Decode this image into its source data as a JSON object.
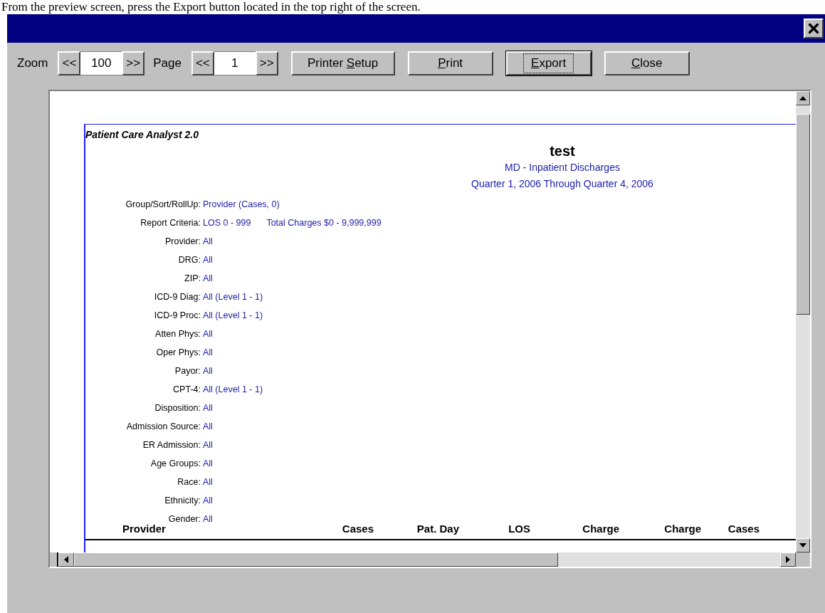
{
  "caption": "From the preview screen, press the Export button located in the top right of the screen.",
  "toolbar": {
    "zoom": {
      "label": "Zoom",
      "prev": "<<",
      "value": "100",
      "next": ">>"
    },
    "page": {
      "label": "Page",
      "prev": "<<",
      "value": "1",
      "next": ">>"
    },
    "buttons": [
      {
        "label_before": "Printer ",
        "mnemonic": "S",
        "label_after": "etup",
        "focused": false
      },
      {
        "mnemonic": "P",
        "label_after": "rint",
        "focused": false
      },
      {
        "mnemonic": "E",
        "label_after": "xport",
        "focused": true
      },
      {
        "mnemonic": "C",
        "label_after": "lose",
        "focused": false
      }
    ]
  },
  "report": {
    "app_title": "Patient Care Analyst 2.0",
    "title": "test",
    "subtitles": [
      "MD - Inpatient Discharges",
      "Quarter 1, 2006 Through Quarter 4, 2006"
    ],
    "criteria": [
      {
        "label": "Group/Sort/RollUp:",
        "values": [
          "Provider (Cases, 0)"
        ]
      },
      {
        "label": "Report Criteria:",
        "values": [
          "LOS 0 - 999",
          "Total Charges $0 - 9,999,999"
        ]
      },
      {
        "label": "Provider:",
        "values": [
          "All"
        ]
      },
      {
        "label": "DRG:",
        "values": [
          "All"
        ]
      },
      {
        "label": "ZIP:",
        "values": [
          "All"
        ]
      },
      {
        "label": "ICD-9 Diag:",
        "values": [
          "All (Level 1 - 1)"
        ]
      },
      {
        "label": "ICD-9 Proc:",
        "values": [
          "All (Level 1 - 1)"
        ]
      },
      {
        "label": "Atten Phys:",
        "values": [
          "All"
        ]
      },
      {
        "label": "Oper Phys:",
        "values": [
          "All"
        ]
      },
      {
        "label": "Payor:",
        "values": [
          "All"
        ]
      },
      {
        "label": "CPT-4:",
        "values": [
          "All (Level 1 - 1)"
        ]
      },
      {
        "label": "Disposition:",
        "values": [
          "All"
        ]
      },
      {
        "label": "Admission Source:",
        "values": [
          "All"
        ]
      },
      {
        "label": "ER Admission:",
        "values": [
          "All"
        ]
      },
      {
        "label": "Age Groups:",
        "values": [
          "All"
        ]
      },
      {
        "label": "Race:",
        "values": [
          "All"
        ]
      },
      {
        "label": "Ethnicity:",
        "values": [
          "All"
        ]
      },
      {
        "label": "Gender:",
        "values": [
          "All"
        ]
      }
    ],
    "columns": [
      "Provider",
      "Cases",
      "Pat. Day",
      "LOS",
      "Charge",
      "Charge",
      "Cases"
    ]
  }
}
